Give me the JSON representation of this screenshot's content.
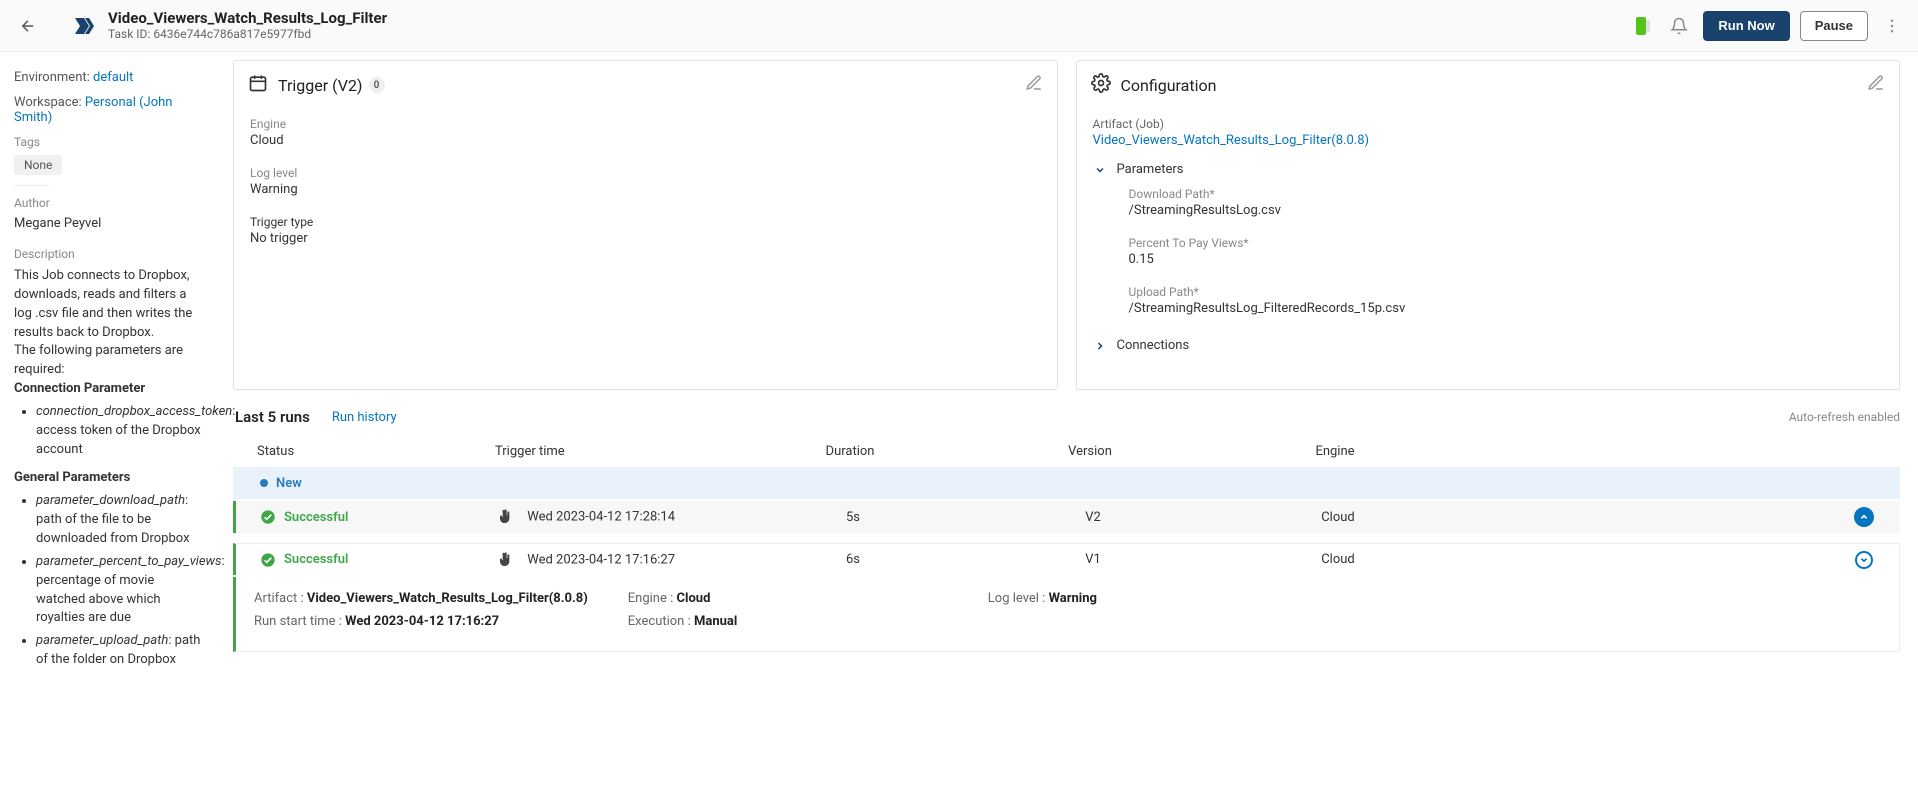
{
  "header": {
    "title": "Video_Viewers_Watch_Results_Log_Filter",
    "task_id_label": "Task ID:",
    "task_id": "6436e744c786a817e5977fbd",
    "run_now": "Run Now",
    "pause": "Pause"
  },
  "sidebar": {
    "environment_label": "Environment:",
    "environment_value": "default",
    "workspace_label": "Workspace:",
    "workspace_value": "Personal (John Smith)",
    "tags_label": "Tags",
    "tags_value": "None",
    "author_label": "Author",
    "author_value": "Megane Peyvel",
    "description_label": "Description",
    "description_intro": "This Job connects to Dropbox, downloads, reads and filters a log .csv file and then writes the results back to Dropbox.",
    "description_req": "The following parameters are required:",
    "conn_param_heading": "Connection Parameter",
    "conn_param_name": "connection_dropbox_access_token",
    "conn_param_desc": ": access token of the Dropbox account",
    "gen_param_heading": "General Parameters",
    "p1_name": "parameter_download_path",
    "p1_desc": ": path of the file to be downloaded from Dropbox",
    "p2_name": "parameter_percent_to_pay_views",
    "p2_desc": ": percentage of movie watched above which royalties are due",
    "p3_name": "parameter_upload_path",
    "p3_desc": ": path of the folder on Dropbox"
  },
  "trigger_panel": {
    "title": "Trigger (V2)",
    "badge": "0",
    "engine_label": "Engine",
    "engine_value": "Cloud",
    "loglevel_label": "Log level",
    "loglevel_value": "Warning",
    "triggertype_label": "Trigger type",
    "triggertype_value": "No trigger"
  },
  "config_panel": {
    "title": "Configuration",
    "artifact_label": "Artifact (Job)",
    "artifact_link": "Video_Viewers_Watch_Results_Log_Filter(8.0.8)",
    "parameters_label": "Parameters",
    "p_download_label": "Download Path*",
    "p_download_value": "/StreamingResultsLog.csv",
    "p_percent_label": "Percent To Pay Views*",
    "p_percent_value": "0.15",
    "p_upload_label": "Upload Path*",
    "p_upload_value": "/StreamingResultsLog_FilteredRecords_15p.csv",
    "connections_label": "Connections"
  },
  "runs": {
    "section_title": "Last 5 runs",
    "history_link": "Run history",
    "auto_refresh": "Auto-refresh enabled",
    "columns": {
      "status": "Status",
      "trigger": "Trigger time",
      "duration": "Duration",
      "version": "Version",
      "engine": "Engine"
    },
    "new_label": "New",
    "success_label": "Successful",
    "row1": {
      "trigger": "Wed 2023-04-12 17:28:14",
      "duration": "5s",
      "version": "V2",
      "engine": "Cloud"
    },
    "row2": {
      "trigger": "Wed 2023-04-12 17:16:27",
      "duration": "6s",
      "version": "V1",
      "engine": "Cloud"
    },
    "detail": {
      "artifact_label": "Artifact :",
      "artifact_value": "Video_Viewers_Watch_Results_Log_Filter(8.0.8)",
      "engine_label": "Engine :",
      "engine_value": "Cloud",
      "loglevel_label": "Log level :",
      "loglevel_value": "Warning",
      "start_label": "Run start time :",
      "start_value": "Wed 2023-04-12 17:16:27",
      "exec_label": "Execution :",
      "exec_value": "Manual"
    }
  }
}
